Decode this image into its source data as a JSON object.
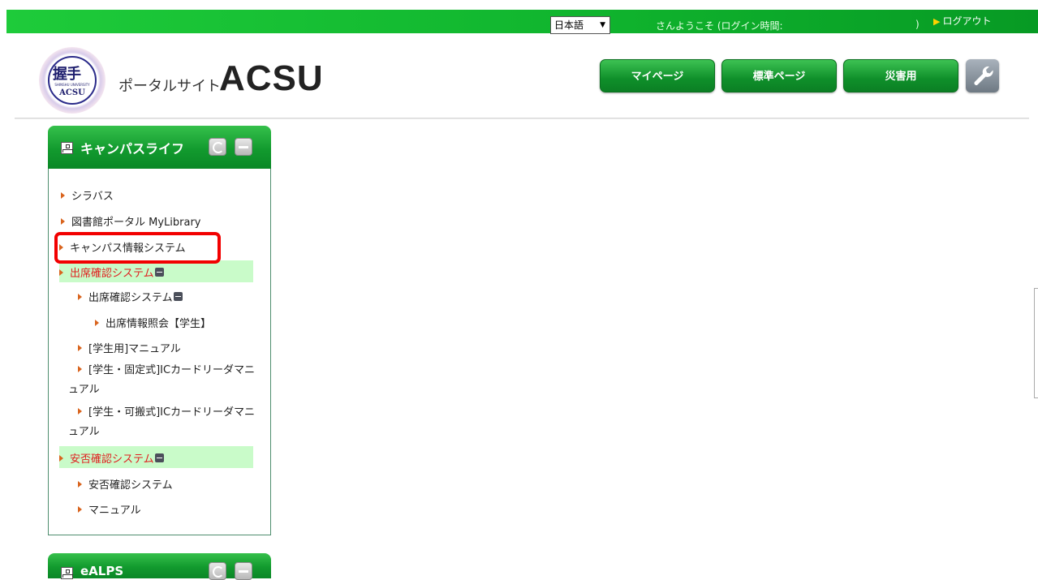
{
  "topbar": {
    "language": "日本語",
    "welcome": "さんようこそ (ログイン時間:",
    "close_paren": ")",
    "logout": "ログアウト"
  },
  "header": {
    "logo": {
      "kanji": "握手",
      "band": "SHINSHU UNIVERSITY",
      "acsu": "ACSU"
    },
    "portal_label": "ポータルサイト",
    "site_name": "ACSU",
    "buttons": {
      "mypage": "マイページ",
      "standard": "標準ページ",
      "disaster": "災害用"
    },
    "tool_icon": "wrench-icon"
  },
  "portlets": [
    {
      "title": "キャンパスライフ",
      "items": [
        {
          "label": "シラバス"
        },
        {
          "label": "図書館ポータル MyLibrary"
        },
        {
          "label": "キャンパス情報システム"
        },
        {
          "label": "出席確認システム"
        },
        {
          "label": "出席確認システム"
        },
        {
          "label": "出席情報照会【学生】"
        },
        {
          "label": "[学生用]マニュアル"
        },
        {
          "label": "[学生・固定式]ICカードリーダマニュアル"
        },
        {
          "label": "[学生・可搬式]ICカードリーダマニュアル"
        },
        {
          "label": "安否確認システム"
        },
        {
          "label": "安否確認システム"
        },
        {
          "label": "マニュアル"
        }
      ]
    },
    {
      "title": "eALPS"
    }
  ],
  "colors": {
    "brand_green": "#0f8f2a",
    "highlight_row": "#c9fbc9",
    "active_text": "#e02020",
    "annotation_box": "#f20000"
  }
}
